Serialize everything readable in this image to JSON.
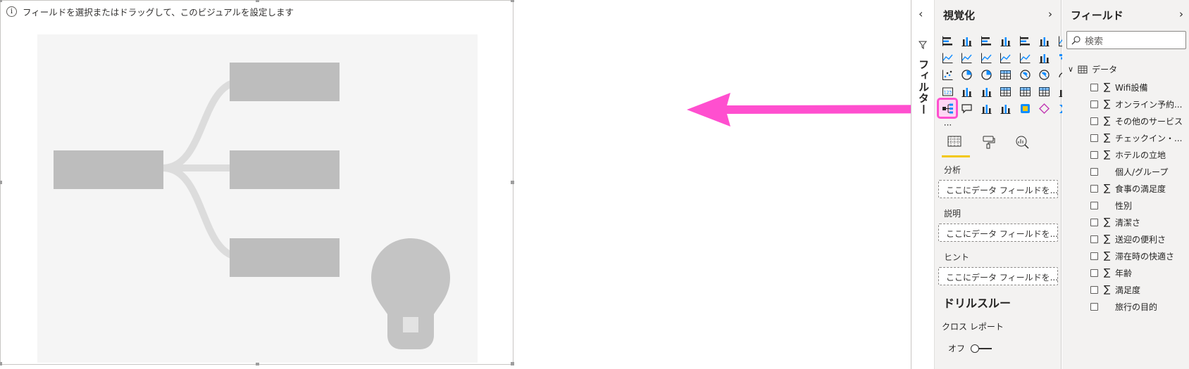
{
  "canvas": {
    "hint": "フィールドを選択またはドラッグして、このビジュアルを設定します"
  },
  "filters": {
    "label": "フィルター"
  },
  "visualizations": {
    "title": "視覚化",
    "icons": [
      "stacked-bar-chart-icon",
      "clustered-column-chart-icon",
      "clustered-bar-chart-icon",
      "stacked-column-chart-icon",
      "100-stacked-bar-chart-icon",
      "100-stacked-column-chart-icon",
      "line-chart-icon",
      "area-chart-icon",
      "stacked-area-chart-icon",
      "line-clustered-column-chart-icon",
      "line-stacked-column-chart-icon",
      "ribbon-chart-icon",
      "waterfall-chart-icon",
      "funnel-chart-icon",
      "scatter-chart-icon",
      "pie-chart-icon",
      "donut-chart-icon",
      "treemap-icon",
      "map-icon",
      "filled-map-icon",
      "gauge-icon",
      "card-icon",
      "multi-row-card-icon",
      "kpi-icon",
      "slicer-icon",
      "table-icon",
      "matrix-icon",
      "key-influencers-icon",
      "decomposition-tree-icon",
      "qa-icon",
      "smart-narrative-icon",
      "paginated-report-icon",
      "python-visual-icon",
      "power-apps-icon",
      "power-automate-icon",
      "more-visuals-icon"
    ],
    "selected_icon": "decomposition-tree-icon",
    "tabs": [
      "fields-tab-icon",
      "format-tab-icon",
      "analytics-tab-icon"
    ],
    "wells": [
      {
        "label": "分析",
        "placeholder": "ここにデータ フィールドを..."
      },
      {
        "label": "説明",
        "placeholder": "ここにデータ フィールドを..."
      },
      {
        "label": "ヒント",
        "placeholder": "ここにデータ フィールドを..."
      }
    ],
    "drillthrough": {
      "title": "ドリルスルー",
      "cross_report_label": "クロス レポート",
      "toggle_state": "オフ"
    }
  },
  "fields": {
    "title": "フィールド",
    "search_placeholder": "検索",
    "table_name": "データ",
    "items": [
      {
        "name": "Wifi設備",
        "sigma": true
      },
      {
        "name": "オンライン予約...",
        "sigma": true
      },
      {
        "name": "その他のサービス",
        "sigma": true
      },
      {
        "name": "チェックイン・...",
        "sigma": true
      },
      {
        "name": "ホテルの立地",
        "sigma": true
      },
      {
        "name": "個人/グループ",
        "sigma": false
      },
      {
        "name": "食事の満足度",
        "sigma": true
      },
      {
        "name": "性別",
        "sigma": false
      },
      {
        "name": "清潔さ",
        "sigma": true
      },
      {
        "name": "送迎の便利さ",
        "sigma": true
      },
      {
        "name": "滞在時の快適さ",
        "sigma": true
      },
      {
        "name": "年齢",
        "sigma": true
      },
      {
        "name": "満足度",
        "sigma": true
      },
      {
        "name": "旅行の目的",
        "sigma": false
      }
    ]
  },
  "colors": {
    "annotation_arrow": "#ff4fcf",
    "accent_underline": "#f2c811",
    "icon_blue": "#118dff",
    "icon_dark": "#252423"
  }
}
